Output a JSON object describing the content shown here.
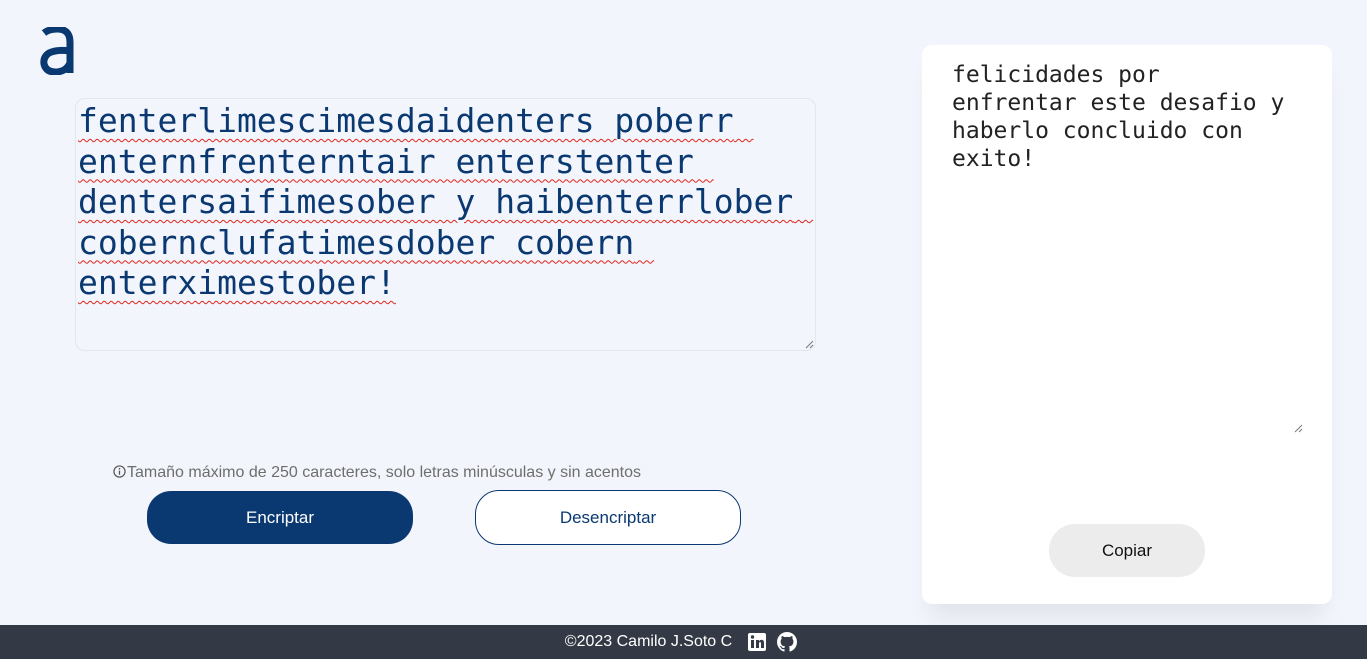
{
  "logo": {
    "icon": "alura-a-logo-icon",
    "color": "#0a3871"
  },
  "input": {
    "value": "fenterlimescimesdaidenters poberr enternfrenterntair enterstenter dentersaifimesober y haibenterrlober cobernclufatimesdober cobern enterximestober!"
  },
  "hint": {
    "icon": "info-icon",
    "text": "Tamaño máximo de 250 caracteres, solo letras minúsculas y sin acentos"
  },
  "buttons": {
    "encrypt_label": "Encriptar",
    "decrypt_label": "Desencriptar"
  },
  "output": {
    "value": "felicidades por\nenfrentar este desafio y\nhaberlo concluido con\nexito!",
    "copy_label": "Copiar"
  },
  "footer": {
    "text": "©2023 Camilo J.Soto C",
    "icons": [
      "linkedin-icon",
      "github-icon"
    ]
  },
  "colors": {
    "primary": "#0a3871",
    "background": "#f3f5fc",
    "footer_bg": "#343a45",
    "copy_button_bg": "#ececec"
  }
}
